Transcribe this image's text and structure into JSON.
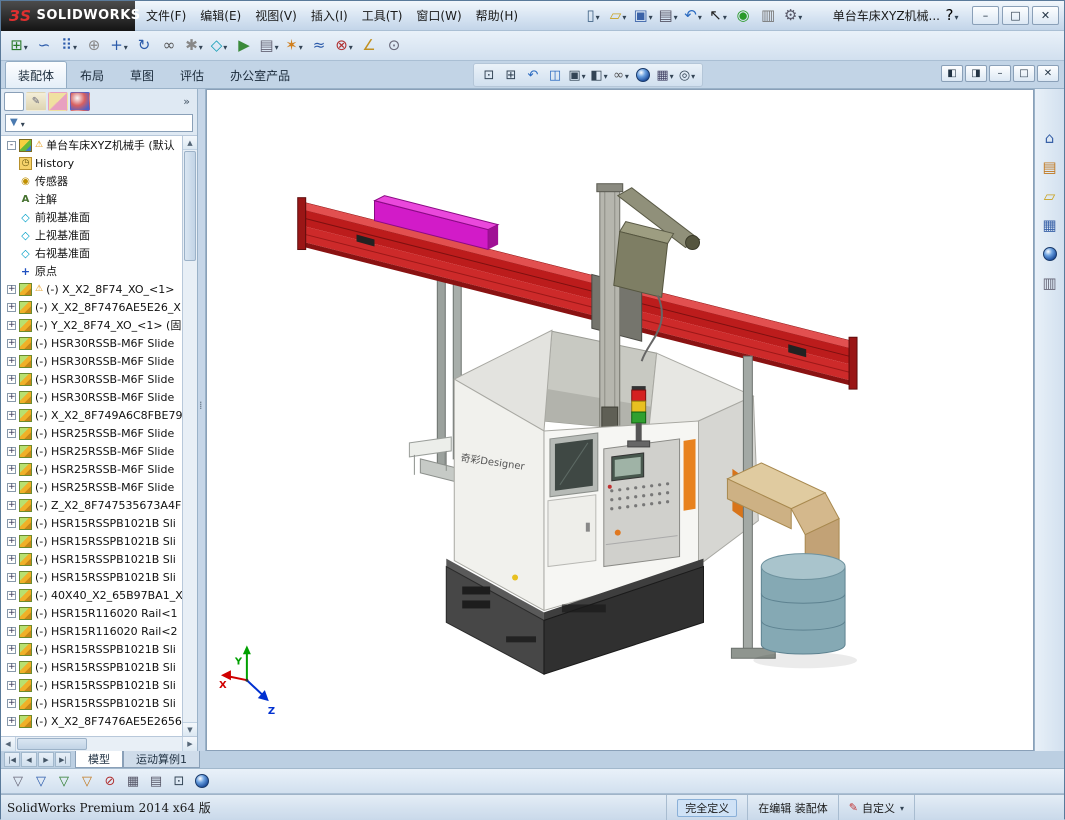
{
  "titlebar": {
    "logo_mark": "ЗS",
    "logo_text": "SOLIDWORKS",
    "document_title": "单台车床XYZ机械...",
    "help_label": "?",
    "menus": [
      {
        "name": "menu-file",
        "label": "文件(F)"
      },
      {
        "name": "menu-edit",
        "label": "编辑(E)"
      },
      {
        "name": "menu-view",
        "label": "视图(V)"
      },
      {
        "name": "menu-insert",
        "label": "插入(I)"
      },
      {
        "name": "menu-tools",
        "label": "工具(T)"
      },
      {
        "name": "menu-window",
        "label": "窗口(W)"
      },
      {
        "name": "menu-help",
        "label": "帮助(H)"
      }
    ],
    "quick_tools": [
      {
        "name": "new-document-button",
        "glyph": "▯",
        "caret": true,
        "color": "#446688"
      },
      {
        "name": "open-button",
        "glyph": "▱",
        "caret": true,
        "color": "#c8a220"
      },
      {
        "name": "save-button",
        "glyph": "▣",
        "caret": true,
        "color": "#3a62a8"
      },
      {
        "name": "print-button",
        "glyph": "▤",
        "caret": true,
        "color": "#556"
      },
      {
        "name": "undo-button",
        "glyph": "↶",
        "caret": true,
        "color": "#2a6ac0"
      },
      {
        "name": "select-button",
        "glyph": "↖",
        "caret": true,
        "color": "#222"
      },
      {
        "name": "rebuild-button",
        "glyph": "◉",
        "caret": false,
        "color": "#2a9a2a"
      },
      {
        "name": "file-properties-button",
        "glyph": "▥",
        "caret": false,
        "color": "#777"
      },
      {
        "name": "options-button",
        "glyph": "⚙",
        "caret": true,
        "color": "#556"
      }
    ],
    "window_controls": [
      {
        "name": "minimize-button",
        "glyph": "–"
      },
      {
        "name": "maximize-button",
        "glyph": "□"
      },
      {
        "name": "close-button",
        "glyph": "✕"
      }
    ]
  },
  "toolbar2": {
    "tools": [
      {
        "name": "insert-components-button",
        "glyph": "⊞",
        "caret": true,
        "color": "#2a7a2a"
      },
      {
        "name": "mate-button",
        "glyph": "∽",
        "caret": false,
        "color": "#2a5aaa"
      },
      {
        "name": "linear-component-pattern-button",
        "glyph": "⠿",
        "caret": true,
        "color": "#2a5aaa"
      },
      {
        "name": "smart-fasteners-button",
        "glyph": "⊕",
        "caret": false,
        "color": "#888"
      },
      {
        "name": "move-component-button",
        "glyph": "+",
        "caret": true,
        "color": "#2a5aaa"
      },
      {
        "name": "rotate-component-button",
        "glyph": "↻",
        "caret": false,
        "color": "#2a5aaa"
      },
      {
        "name": "show-hidden-components-button",
        "glyph": "∞",
        "caret": false,
        "color": "#555"
      },
      {
        "name": "assembly-features-button",
        "glyph": "✱",
        "caret": true,
        "color": "#888"
      },
      {
        "name": "reference-geometry-button",
        "glyph": "◇",
        "caret": true,
        "color": "#18a0b8"
      },
      {
        "name": "new-motion-study-button",
        "glyph": "▶",
        "caret": false,
        "color": "#3a8a3a"
      },
      {
        "name": "bill-of-materials-button",
        "glyph": "▤",
        "caret": true,
        "color": "#667"
      },
      {
        "name": "exploded-view-button",
        "glyph": "✶",
        "caret": true,
        "color": "#d08020"
      },
      {
        "name": "explode-line-sketch-button",
        "glyph": "≈",
        "caret": false,
        "color": "#2a5aaa"
      },
      {
        "name": "interference-detection-button",
        "glyph": "⊗",
        "caret": true,
        "color": "#b03030"
      },
      {
        "name": "measure-button",
        "glyph": "∠",
        "caret": false,
        "color": "#c09020"
      },
      {
        "name": "mass-properties-button",
        "glyph": "⊙",
        "caret": false,
        "color": "#667"
      }
    ]
  },
  "ribbon": {
    "tabs": [
      {
        "name": "tab-assembly",
        "label": "装配体",
        "active": true
      },
      {
        "name": "tab-layout",
        "label": "布局"
      },
      {
        "name": "tab-sketch",
        "label": "草图"
      },
      {
        "name": "tab-evaluate",
        "label": "评估"
      },
      {
        "name": "tab-office-products",
        "label": "办公室产品"
      }
    ]
  },
  "headsup": {
    "tools": [
      {
        "name": "zoom-to-fit-button",
        "glyph": "⊡",
        "caret": false,
        "color": "#345"
      },
      {
        "name": "zoom-to-area-button",
        "glyph": "⊞",
        "caret": false,
        "color": "#345"
      },
      {
        "name": "previous-view-button",
        "glyph": "↶",
        "caret": false,
        "color": "#2a6ac0"
      },
      {
        "name": "section-view-button",
        "glyph": "◫",
        "caret": false,
        "color": "#2a6ac0"
      },
      {
        "name": "view-orientation-button",
        "glyph": "▣",
        "caret": true,
        "color": "#345"
      },
      {
        "name": "display-style-button",
        "glyph": "◧",
        "caret": true,
        "color": "#345"
      },
      {
        "name": "hide-show-items-button",
        "glyph": "∞",
        "caret": true,
        "color": "#555"
      },
      {
        "name": "edit-appearance-button",
        "ball": true,
        "caret": false
      },
      {
        "name": "apply-scene-button",
        "glyph": "▦",
        "caret": true,
        "color": "#446"
      },
      {
        "name": "view-settings-button",
        "glyph": "◎",
        "caret": true,
        "color": "#345"
      }
    ]
  },
  "docwin": {
    "controls": [
      {
        "name": "pane-left-button",
        "glyph": "◧"
      },
      {
        "name": "pane-right-button",
        "glyph": "◨"
      },
      {
        "name": "doc-minimize-button",
        "glyph": "–"
      },
      {
        "name": "doc-restore-button",
        "glyph": "□"
      },
      {
        "name": "doc-close-button",
        "glyph": "✕"
      }
    ]
  },
  "feature_panel": {
    "overflow": "»",
    "filter_glyph": "▼",
    "tabs": [
      {
        "name": "tab-featuremanager",
        "cls": "pt-feat",
        "active": true
      },
      {
        "name": "tab-propertymanager",
        "cls": "pt-prop"
      },
      {
        "name": "tab-configurationmanager",
        "cls": "pt-conf"
      },
      {
        "name": "tab-displaymanager",
        "cls": "pt-disp"
      }
    ],
    "tree": [
      {
        "label": "单台车床XYZ机械手 (默认",
        "icon": "assembly",
        "expander": "-",
        "warning": true
      },
      {
        "label": "History",
        "icon": "history"
      },
      {
        "label": "传感器",
        "icon": "sensors"
      },
      {
        "label": "注解",
        "icon": "annotations"
      },
      {
        "label": "前视基准面",
        "icon": "plane"
      },
      {
        "label": "上视基准面",
        "icon": "plane"
      },
      {
        "label": "右视基准面",
        "icon": "plane"
      },
      {
        "label": "原点",
        "icon": "origin"
      },
      {
        "label": "(-) X_X2_8F74_XO_<1>",
        "icon": "component",
        "expander": "+",
        "warning": true
      },
      {
        "label": "(-) X_X2_8F7476AE5E26_X",
        "icon": "component",
        "expander": "+"
      },
      {
        "label": "(-) Y_X2_8F74_XO_<1> (固",
        "icon": "component",
        "expander": "+"
      },
      {
        "label": "(-) HSR30RSSB-M6F Slide",
        "icon": "component",
        "expander": "+"
      },
      {
        "label": "(-) HSR30RSSB-M6F Slide",
        "icon": "component",
        "expander": "+"
      },
      {
        "label": "(-) HSR30RSSB-M6F Slide",
        "icon": "component",
        "expander": "+"
      },
      {
        "label": "(-) HSR30RSSB-M6F Slide",
        "icon": "component",
        "expander": "+"
      },
      {
        "label": "(-) X_X2_8F749A6C8FBE79",
        "icon": "component",
        "expander": "+"
      },
      {
        "label": "(-) HSR25RSSB-M6F Slide",
        "icon": "component",
        "expander": "+"
      },
      {
        "label": "(-) HSR25RSSB-M6F Slide",
        "icon": "component",
        "expander": "+"
      },
      {
        "label": "(-) HSR25RSSB-M6F Slide",
        "icon": "component",
        "expander": "+"
      },
      {
        "label": "(-) HSR25RSSB-M6F Slide",
        "icon": "component",
        "expander": "+"
      },
      {
        "label": "(-) Z_X2_8F747535673A4F",
        "icon": "component",
        "expander": "+"
      },
      {
        "label": "(-) HSR15RSSPB1021B Sli",
        "icon": "component",
        "expander": "+"
      },
      {
        "label": "(-) HSR15RSSPB1021B Sli",
        "icon": "component",
        "expander": "+"
      },
      {
        "label": "(-) HSR15RSSPB1021B Sli",
        "icon": "component",
        "expander": "+"
      },
      {
        "label": "(-) HSR15RSSPB1021B Sli",
        "icon": "component",
        "expander": "+"
      },
      {
        "label": "(-) 40X40_X2_65B97BA1_X",
        "icon": "component",
        "expander": "+"
      },
      {
        "label": "(-) HSR15R116020 Rail<1",
        "icon": "component",
        "expander": "+"
      },
      {
        "label": "(-) HSR15R116020 Rail<2",
        "icon": "component",
        "expander": "+"
      },
      {
        "label": "(-) HSR15RSSPB1021B Sli",
        "icon": "component",
        "expander": "+"
      },
      {
        "label": "(-) HSR15RSSPB1021B Sli",
        "icon": "component",
        "expander": "+"
      },
      {
        "label": "(-) HSR15RSSPB1021B Sli",
        "icon": "component",
        "expander": "+"
      },
      {
        "label": "(-) HSR15RSSPB1021B Sli",
        "icon": "component",
        "expander": "+"
      },
      {
        "label": "(-) X_X2_8F7476AE5E2656",
        "icon": "component",
        "expander": "+"
      }
    ]
  },
  "viewport": {
    "machine_label": "奇彩Designer",
    "triad": {
      "x": "X",
      "y": "Y",
      "z": "Z"
    }
  },
  "colors": {
    "beam_red": "#bc1c1c",
    "beam_red_top": "#e25050",
    "plate_magenta": "#d21bc8",
    "chute_tan": "#e0cba0",
    "barrel_blue": "#85a9b4",
    "accent_orange": "#e8821e"
  },
  "taskpane": {
    "icons": [
      {
        "name": "task-home-icon",
        "glyph": "⌂",
        "color": "#3a62a8"
      },
      {
        "name": "design-library-icon",
        "glyph": "▤",
        "color": "#c07820"
      },
      {
        "name": "file-explorer-icon",
        "glyph": "▱",
        "color": "#c8a220"
      },
      {
        "name": "view-palette-icon",
        "glyph": "▦",
        "color": "#3a62a8"
      },
      {
        "name": "appearances-icon",
        "ball": true
      },
      {
        "name": "custom-properties-icon",
        "glyph": "▥",
        "color": "#667"
      }
    ]
  },
  "bottom_tabs": {
    "nav": [
      {
        "name": "tab-scroll-first",
        "glyph": "|◀"
      },
      {
        "name": "tab-scroll-prev",
        "glyph": "◀"
      },
      {
        "name": "tab-scroll-next",
        "glyph": "▶"
      },
      {
        "name": "tab-scroll-last",
        "glyph": "▶|"
      }
    ],
    "tabs": [
      {
        "name": "tab-model",
        "label": "模型",
        "active": true
      },
      {
        "name": "tab-motion-study-1",
        "label": "运动算例1"
      }
    ]
  },
  "bottom_toolbar": {
    "tools": [
      {
        "name": "selection-filter-toggle-button",
        "glyph": "▽",
        "color": "#667"
      },
      {
        "name": "filter-vertices-button",
        "glyph": "▽",
        "color": "#2a5aaa"
      },
      {
        "name": "filter-edges-button",
        "glyph": "▽",
        "color": "#2a7a2a"
      },
      {
        "name": "filter-faces-button",
        "glyph": "▽",
        "color": "#c07820"
      },
      {
        "name": "clear-selection-filters-button",
        "glyph": "⊘",
        "color": "#b03030"
      },
      {
        "name": "select-table-button",
        "glyph": "▦",
        "color": "#556"
      },
      {
        "name": "bom-table-button",
        "glyph": "▤",
        "color": "#556"
      },
      {
        "name": "magnified-selection-button",
        "glyph": "⊡",
        "color": "#345"
      },
      {
        "name": "help-sphere-icon",
        "ball": true
      }
    ]
  },
  "statusbar": {
    "left": "SolidWorks Premium 2014 x64 版",
    "segments": [
      {
        "name": "status-fully-defined",
        "label": "完全定义",
        "highlight": true
      },
      {
        "name": "status-editing",
        "label": "在编辑 装配体"
      },
      {
        "name": "status-custom",
        "label": "自定义",
        "pencil": true,
        "caret": true
      },
      {
        "name": "status-blank",
        "label": "",
        "cls": "blank"
      }
    ]
  }
}
